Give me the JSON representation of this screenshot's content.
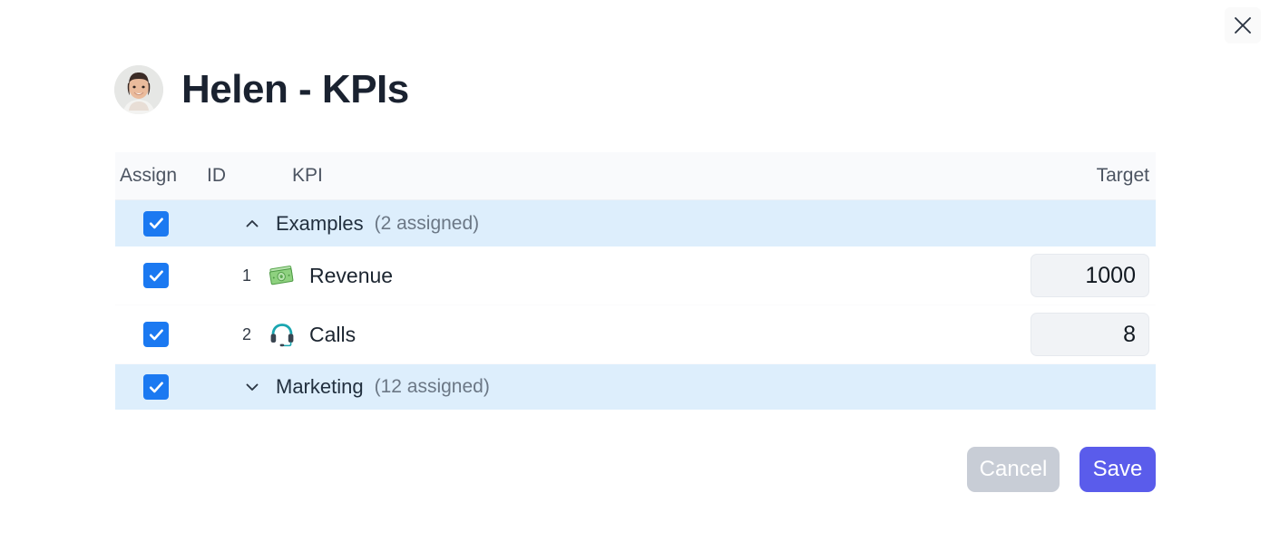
{
  "dialog": {
    "title": "Helen - KPIs",
    "avatar_name": "helen-avatar",
    "close_label": "close-icon"
  },
  "table": {
    "headers": {
      "assign": "Assign",
      "id": "ID",
      "kpi": "KPI",
      "target": "Target"
    },
    "groups": [
      {
        "name": "Examples",
        "count_label": "(2 assigned)",
        "expanded": true,
        "checked": true,
        "chevron": "chevron-up-icon",
        "items": [
          {
            "id": "1",
            "icon": "money-banknote-icon",
            "name": "Revenue",
            "target": "1000",
            "checked": true
          },
          {
            "id": "2",
            "icon": "headphones-icon",
            "name": "Calls",
            "target": "8",
            "checked": true
          }
        ]
      },
      {
        "name": "Marketing",
        "count_label": "(12 assigned)",
        "expanded": false,
        "checked": true,
        "chevron": "chevron-down-icon",
        "items": []
      }
    ]
  },
  "footer": {
    "cancel_label": "Cancel",
    "save_label": "Save"
  },
  "colors": {
    "checkbox_blue": "#1b79f1",
    "group_row_blue": "#ddeefc",
    "save_purple": "#5a5ceb",
    "cancel_gray": "#c8cdd6",
    "header_bg": "#f9fafc",
    "input_bg": "#f1f3f6"
  }
}
